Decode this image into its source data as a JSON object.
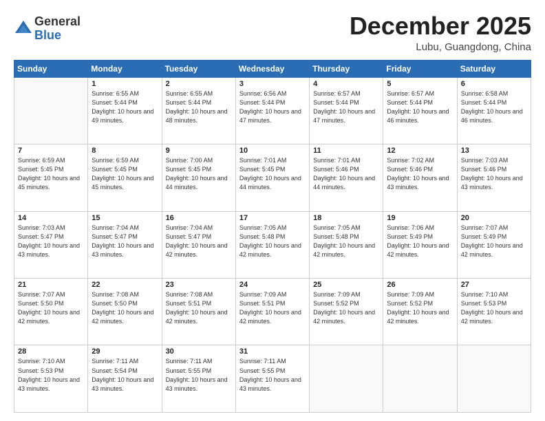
{
  "header": {
    "logo_line1": "General",
    "logo_line2": "Blue",
    "month": "December 2025",
    "location": "Lubu, Guangdong, China"
  },
  "weekdays": [
    "Sunday",
    "Monday",
    "Tuesday",
    "Wednesday",
    "Thursday",
    "Friday",
    "Saturday"
  ],
  "weeks": [
    [
      {
        "day": "",
        "sunrise": "",
        "sunset": "",
        "daylight": ""
      },
      {
        "day": "1",
        "sunrise": "Sunrise: 6:55 AM",
        "sunset": "Sunset: 5:44 PM",
        "daylight": "Daylight: 10 hours and 49 minutes."
      },
      {
        "day": "2",
        "sunrise": "Sunrise: 6:55 AM",
        "sunset": "Sunset: 5:44 PM",
        "daylight": "Daylight: 10 hours and 48 minutes."
      },
      {
        "day": "3",
        "sunrise": "Sunrise: 6:56 AM",
        "sunset": "Sunset: 5:44 PM",
        "daylight": "Daylight: 10 hours and 47 minutes."
      },
      {
        "day": "4",
        "sunrise": "Sunrise: 6:57 AM",
        "sunset": "Sunset: 5:44 PM",
        "daylight": "Daylight: 10 hours and 47 minutes."
      },
      {
        "day": "5",
        "sunrise": "Sunrise: 6:57 AM",
        "sunset": "Sunset: 5:44 PM",
        "daylight": "Daylight: 10 hours and 46 minutes."
      },
      {
        "day": "6",
        "sunrise": "Sunrise: 6:58 AM",
        "sunset": "Sunset: 5:44 PM",
        "daylight": "Daylight: 10 hours and 46 minutes."
      }
    ],
    [
      {
        "day": "7",
        "sunrise": "Sunrise: 6:59 AM",
        "sunset": "Sunset: 5:45 PM",
        "daylight": "Daylight: 10 hours and 45 minutes."
      },
      {
        "day": "8",
        "sunrise": "Sunrise: 6:59 AM",
        "sunset": "Sunset: 5:45 PM",
        "daylight": "Daylight: 10 hours and 45 minutes."
      },
      {
        "day": "9",
        "sunrise": "Sunrise: 7:00 AM",
        "sunset": "Sunset: 5:45 PM",
        "daylight": "Daylight: 10 hours and 44 minutes."
      },
      {
        "day": "10",
        "sunrise": "Sunrise: 7:01 AM",
        "sunset": "Sunset: 5:45 PM",
        "daylight": "Daylight: 10 hours and 44 minutes."
      },
      {
        "day": "11",
        "sunrise": "Sunrise: 7:01 AM",
        "sunset": "Sunset: 5:46 PM",
        "daylight": "Daylight: 10 hours and 44 minutes."
      },
      {
        "day": "12",
        "sunrise": "Sunrise: 7:02 AM",
        "sunset": "Sunset: 5:46 PM",
        "daylight": "Daylight: 10 hours and 43 minutes."
      },
      {
        "day": "13",
        "sunrise": "Sunrise: 7:03 AM",
        "sunset": "Sunset: 5:46 PM",
        "daylight": "Daylight: 10 hours and 43 minutes."
      }
    ],
    [
      {
        "day": "14",
        "sunrise": "Sunrise: 7:03 AM",
        "sunset": "Sunset: 5:47 PM",
        "daylight": "Daylight: 10 hours and 43 minutes."
      },
      {
        "day": "15",
        "sunrise": "Sunrise: 7:04 AM",
        "sunset": "Sunset: 5:47 PM",
        "daylight": "Daylight: 10 hours and 43 minutes."
      },
      {
        "day": "16",
        "sunrise": "Sunrise: 7:04 AM",
        "sunset": "Sunset: 5:47 PM",
        "daylight": "Daylight: 10 hours and 42 minutes."
      },
      {
        "day": "17",
        "sunrise": "Sunrise: 7:05 AM",
        "sunset": "Sunset: 5:48 PM",
        "daylight": "Daylight: 10 hours and 42 minutes."
      },
      {
        "day": "18",
        "sunrise": "Sunrise: 7:05 AM",
        "sunset": "Sunset: 5:48 PM",
        "daylight": "Daylight: 10 hours and 42 minutes."
      },
      {
        "day": "19",
        "sunrise": "Sunrise: 7:06 AM",
        "sunset": "Sunset: 5:49 PM",
        "daylight": "Daylight: 10 hours and 42 minutes."
      },
      {
        "day": "20",
        "sunrise": "Sunrise: 7:07 AM",
        "sunset": "Sunset: 5:49 PM",
        "daylight": "Daylight: 10 hours and 42 minutes."
      }
    ],
    [
      {
        "day": "21",
        "sunrise": "Sunrise: 7:07 AM",
        "sunset": "Sunset: 5:50 PM",
        "daylight": "Daylight: 10 hours and 42 minutes."
      },
      {
        "day": "22",
        "sunrise": "Sunrise: 7:08 AM",
        "sunset": "Sunset: 5:50 PM",
        "daylight": "Daylight: 10 hours and 42 minutes."
      },
      {
        "day": "23",
        "sunrise": "Sunrise: 7:08 AM",
        "sunset": "Sunset: 5:51 PM",
        "daylight": "Daylight: 10 hours and 42 minutes."
      },
      {
        "day": "24",
        "sunrise": "Sunrise: 7:09 AM",
        "sunset": "Sunset: 5:51 PM",
        "daylight": "Daylight: 10 hours and 42 minutes."
      },
      {
        "day": "25",
        "sunrise": "Sunrise: 7:09 AM",
        "sunset": "Sunset: 5:52 PM",
        "daylight": "Daylight: 10 hours and 42 minutes."
      },
      {
        "day": "26",
        "sunrise": "Sunrise: 7:09 AM",
        "sunset": "Sunset: 5:52 PM",
        "daylight": "Daylight: 10 hours and 42 minutes."
      },
      {
        "day": "27",
        "sunrise": "Sunrise: 7:10 AM",
        "sunset": "Sunset: 5:53 PM",
        "daylight": "Daylight: 10 hours and 42 minutes."
      }
    ],
    [
      {
        "day": "28",
        "sunrise": "Sunrise: 7:10 AM",
        "sunset": "Sunset: 5:53 PM",
        "daylight": "Daylight: 10 hours and 43 minutes."
      },
      {
        "day": "29",
        "sunrise": "Sunrise: 7:11 AM",
        "sunset": "Sunset: 5:54 PM",
        "daylight": "Daylight: 10 hours and 43 minutes."
      },
      {
        "day": "30",
        "sunrise": "Sunrise: 7:11 AM",
        "sunset": "Sunset: 5:55 PM",
        "daylight": "Daylight: 10 hours and 43 minutes."
      },
      {
        "day": "31",
        "sunrise": "Sunrise: 7:11 AM",
        "sunset": "Sunset: 5:55 PM",
        "daylight": "Daylight: 10 hours and 43 minutes."
      },
      {
        "day": "",
        "sunrise": "",
        "sunset": "",
        "daylight": ""
      },
      {
        "day": "",
        "sunrise": "",
        "sunset": "",
        "daylight": ""
      },
      {
        "day": "",
        "sunrise": "",
        "sunset": "",
        "daylight": ""
      }
    ]
  ]
}
